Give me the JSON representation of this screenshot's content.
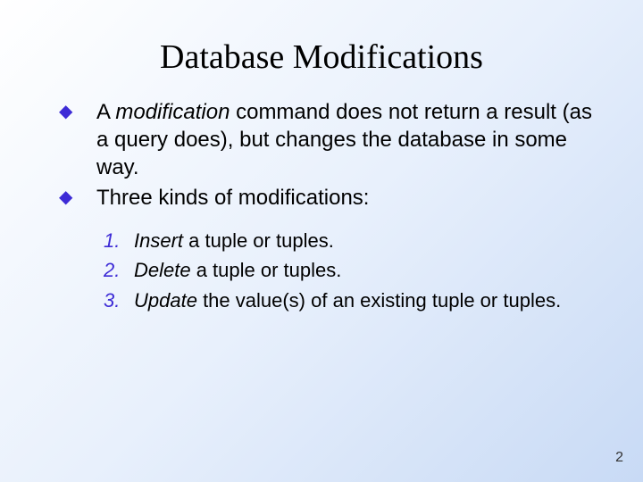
{
  "title": "Database Modifications",
  "bullets": [
    {
      "prefix": "A ",
      "italic_word": "modification",
      "suffix": "  command does not return a result (as a query does), but changes the database in some way."
    },
    {
      "prefix": "",
      "italic_word": "",
      "suffix": "Three kinds of modifications:"
    }
  ],
  "numbered": [
    {
      "num": "1.",
      "italic_word": "Insert",
      "rest": "  a tuple or tuples."
    },
    {
      "num": "2.",
      "italic_word": "Delete",
      "rest": "  a tuple or tuples."
    },
    {
      "num": "3.",
      "italic_word": "Update",
      "rest": "  the value(s) of an existing tuple or tuples."
    }
  ],
  "page_number": "2"
}
